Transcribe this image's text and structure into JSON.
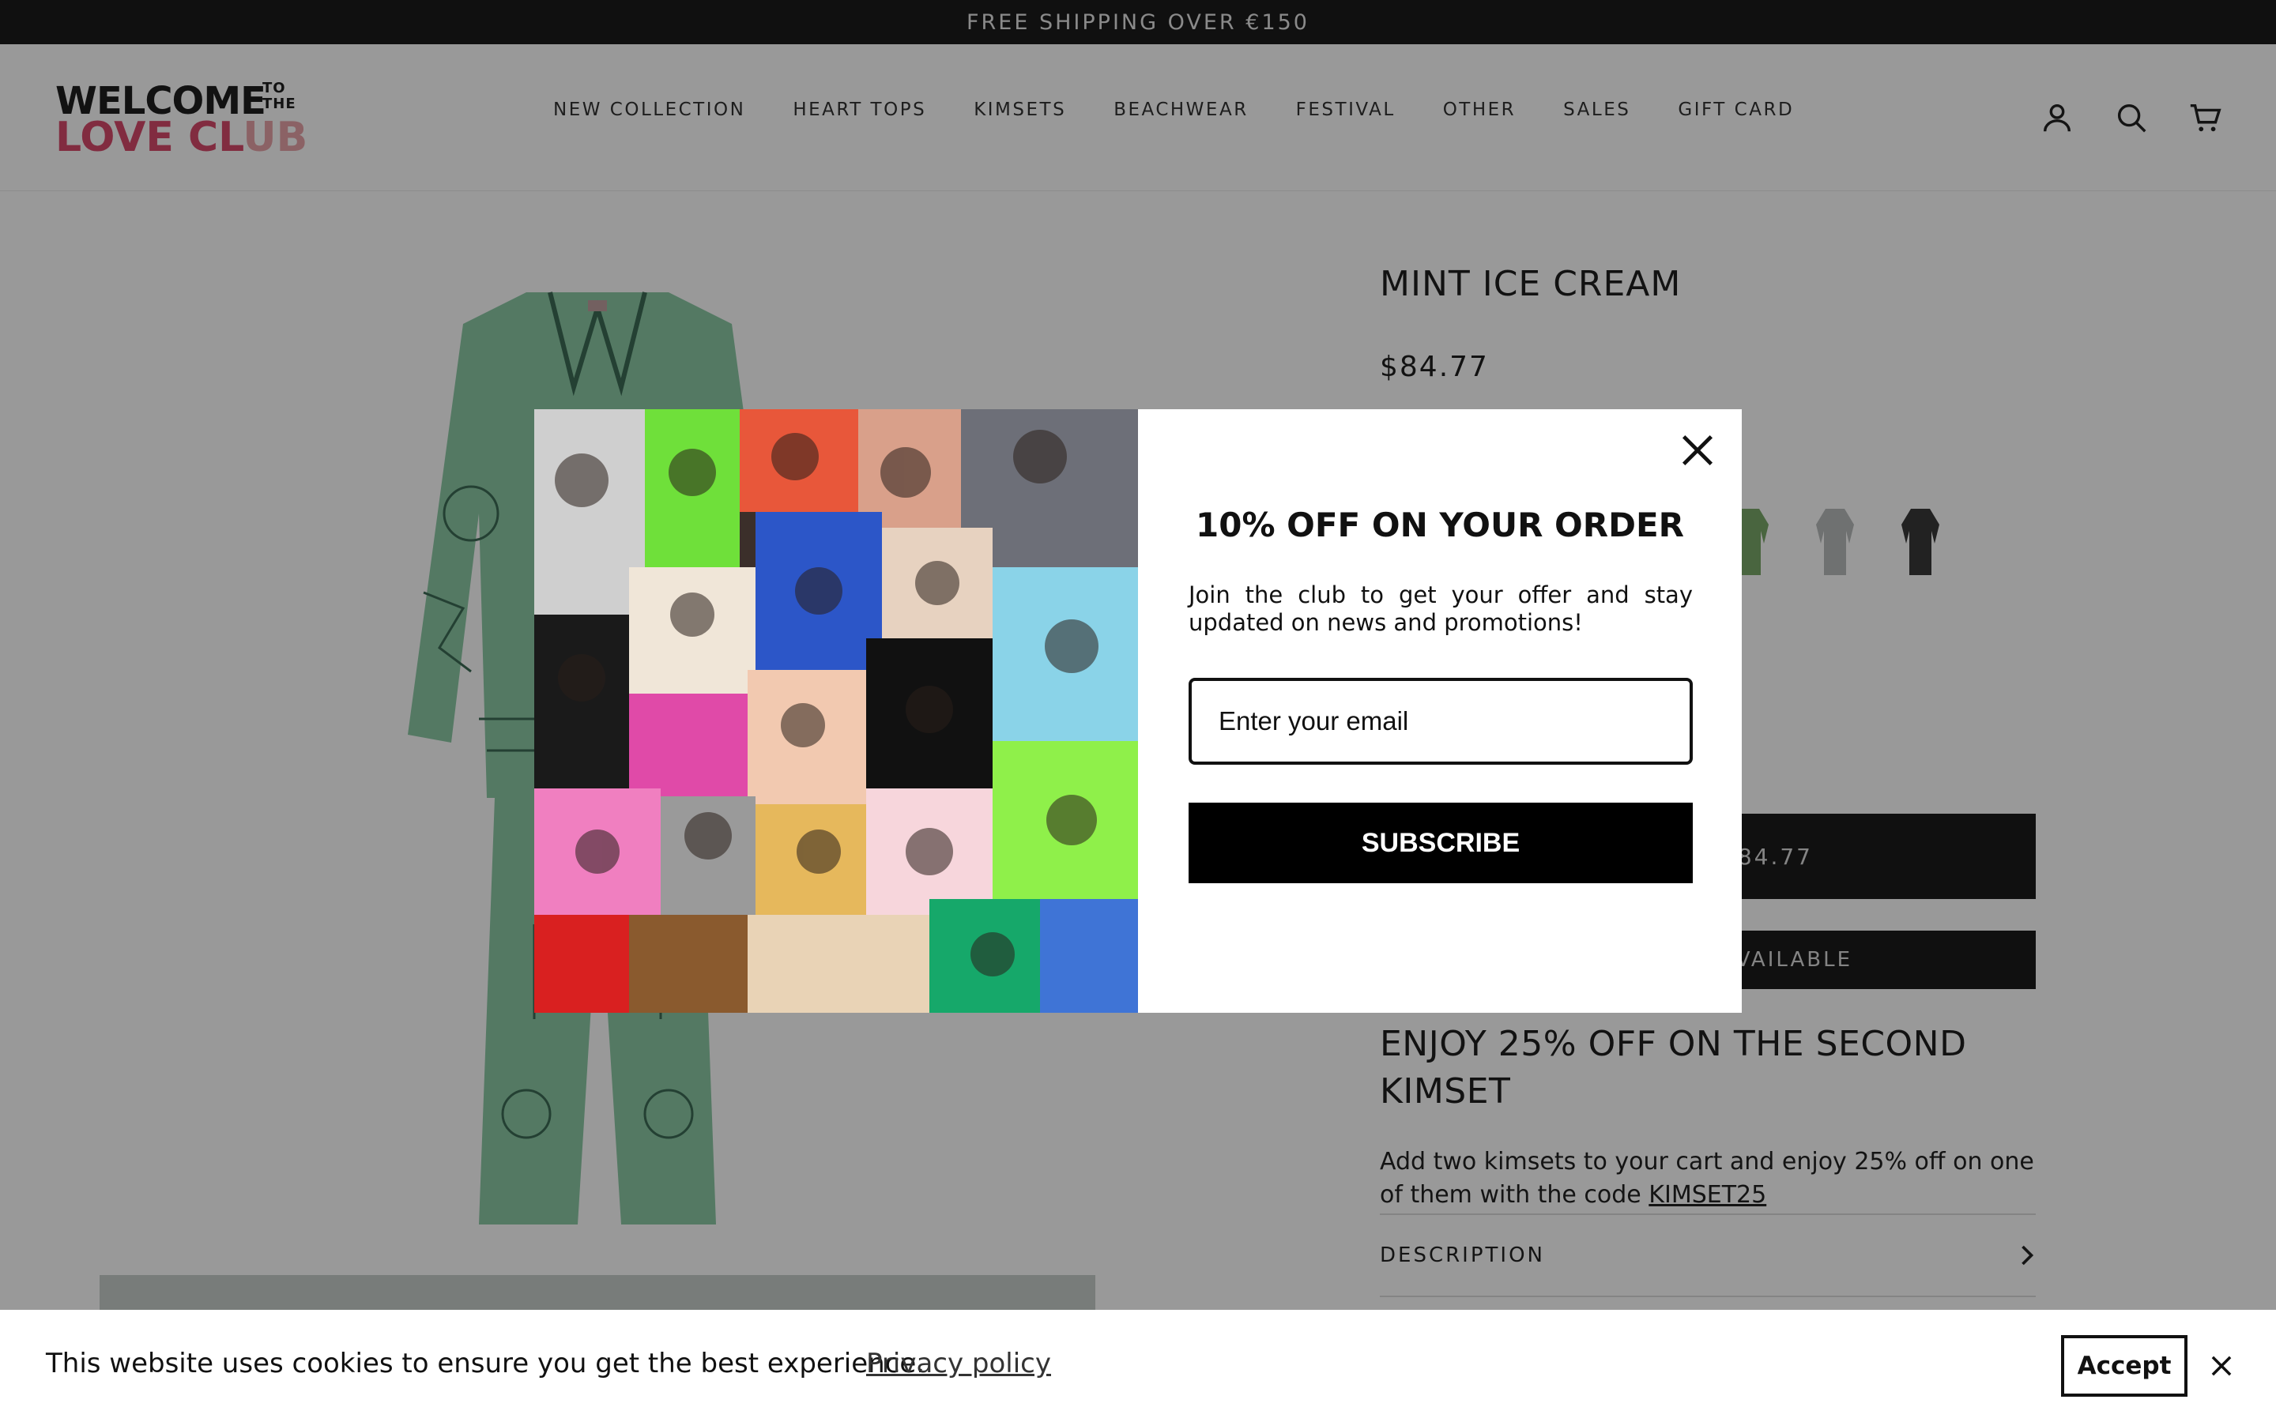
{
  "announcement": {
    "text": "FREE SHIPPING OVER €150"
  },
  "logo": {
    "line1": "WELCOME",
    "small_top": "TO",
    "small_bottom": "THE",
    "line2_main": "LOVE CL",
    "line2_fade": "UB"
  },
  "nav": {
    "items": [
      "NEW COLLECTION",
      "HEART TOPS",
      "KIMSETS",
      "BEACHWEAR",
      "FESTIVAL",
      "OTHER",
      "SALES",
      "GIFT CARD"
    ]
  },
  "header_icons": [
    "account-icon",
    "search-icon",
    "cart-icon"
  ],
  "product": {
    "title": "MINT ICE CREAM",
    "price": "$84.77",
    "cart_button_visible": "$84.77",
    "notify_button_visible": "VAILABLE",
    "swatch_colors": [
      "#7aa86a",
      "#b9bcbd",
      "#3a3a3a"
    ],
    "promo_title": "ENJOY 25% OFF ON THE SECOND KIMSET",
    "promo_text_before": "Add two kimsets to your cart and enjoy 25% off on one of them with the code ",
    "promo_code": "KIMSET25",
    "description_label": "DESCRIPTION",
    "garment_color": "#8ccaa6"
  },
  "modal": {
    "title": "10% OFF ON YOUR ORDER",
    "description": "Join the club to get your offer and stay updated on news and promotions!",
    "email_placeholder": "Enter your email",
    "subscribe_label": "SUBSCRIBE"
  },
  "cookie": {
    "text": "This website uses cookies to ensure you get the best experience.",
    "link": "Privacy policy",
    "accept_label": "Accept"
  },
  "colors": {
    "announce_bg": "#1b1b1b",
    "logo_pink": "#d84a6c",
    "overlay": "rgba(0,0,0,0.40)"
  }
}
